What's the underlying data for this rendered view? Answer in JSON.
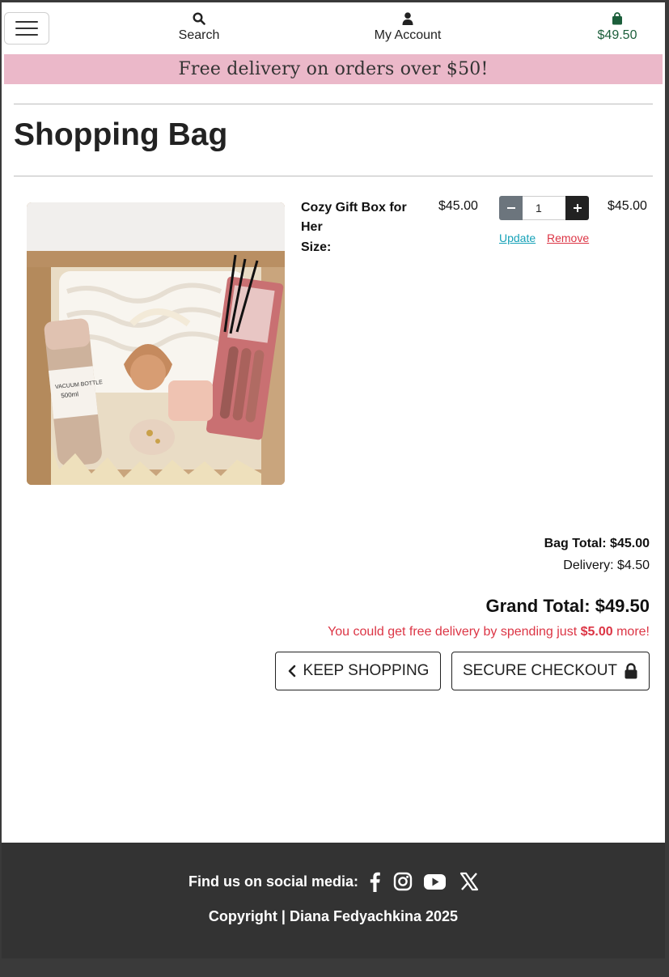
{
  "nav": {
    "search_label": "Search",
    "account_label": "My Account",
    "bag_total": "$49.50"
  },
  "promo": "Free delivery on orders over $50!",
  "page_title": "Shopping Bag",
  "item": {
    "name": "Cozy Gift Box for Her",
    "size_label": "Size:",
    "price": "$45.00",
    "quantity": "1",
    "update_label": "Update",
    "remove_label": "Remove",
    "subtotal": "$45.00",
    "image_alt": "gift box with blanket, vacuum bottle, lip glosses, scrunchie and candle",
    "bottle_label": "VACUUM BOTTLE 500ml"
  },
  "totals": {
    "bag_total": "Bag Total: $45.00",
    "delivery": "Delivery: $4.50",
    "grand_total": "Grand Total: $49.50",
    "free_delivery_prefix": "You could get free delivery by spending just",
    "free_delivery_amount": "$5.00",
    "free_delivery_suffix": "more!"
  },
  "buttons": {
    "keep_shopping": "KEEP SHOPPING",
    "secure_checkout": "SECURE CHECKOUT"
  },
  "footer": {
    "social_label": "Find us on social media:",
    "social_icons": [
      "facebook-icon",
      "instagram-icon",
      "youtube-icon",
      "x-icon"
    ],
    "copyright": "Copyright | Diana Fedyachkina 2025"
  },
  "colors": {
    "promo_bg": "#ebb8c9",
    "bag_green": "#1b5e3a",
    "update_link": "#17a2b8",
    "remove_link": "#dc3545",
    "footer_bg": "#333333"
  }
}
